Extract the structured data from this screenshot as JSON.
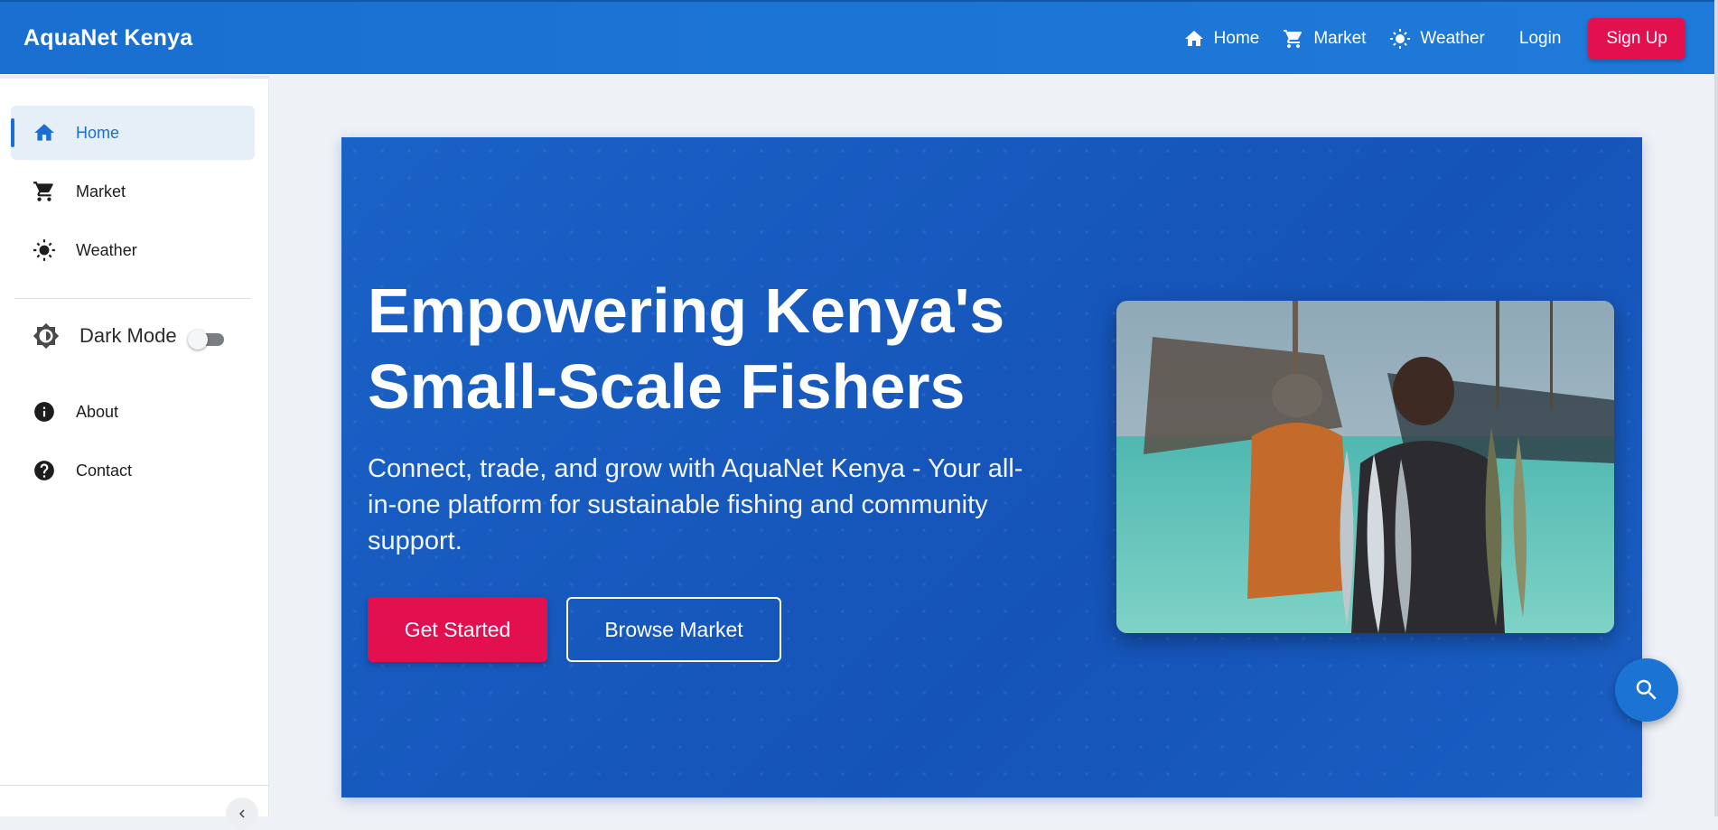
{
  "app": {
    "brand": "AquaNet Kenya"
  },
  "topnav": {
    "items": [
      {
        "label": "Home",
        "icon": "home-icon"
      },
      {
        "label": "Market",
        "icon": "cart-icon"
      },
      {
        "label": "Weather",
        "icon": "sun-icon"
      }
    ],
    "login_label": "Login",
    "signup_label": "Sign Up"
  },
  "sidebar": {
    "items": [
      {
        "label": "Home",
        "icon": "home-icon",
        "active": true
      },
      {
        "label": "Market",
        "icon": "cart-icon"
      },
      {
        "label": "Weather",
        "icon": "sun-icon"
      }
    ],
    "dark_mode_label": "Dark Mode",
    "dark_mode_on": false,
    "secondary": [
      {
        "label": "About",
        "icon": "info-icon"
      },
      {
        "label": "Contact",
        "icon": "help-icon"
      }
    ]
  },
  "hero": {
    "title_line1": "Empowering Kenya's",
    "title_line2": "Small-Scale Fishers",
    "subtitle": "Connect, trade, and grow with AquaNet Kenya - Your all-in-one platform for sustainable fishing and community support.",
    "primary_cta": "Get Started",
    "secondary_cta": "Browse Market",
    "image_alt": "fishermen-holding-tuna-photo"
  },
  "colors": {
    "primary": "#1b6ed2",
    "accent": "#e3104f",
    "hero_bg": "#1553b8"
  }
}
